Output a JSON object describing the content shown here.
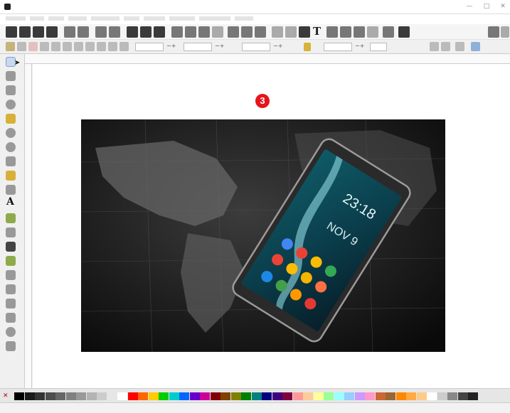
{
  "window": {
    "title": "",
    "minimize_label": "—",
    "maximize_label": "□",
    "close_label": "✕"
  },
  "menu": [],
  "toolbar_text_tool": "T",
  "canvas": {
    "step_marker": "3"
  },
  "tools": [
    {
      "name": "selector-tool",
      "icon": "arrow-icon"
    },
    {
      "name": "node-tool",
      "icon": "node-icon"
    },
    {
      "name": "rectangle-tool",
      "icon": "rectangle-icon"
    },
    {
      "name": "circle-tool",
      "icon": "circle-icon"
    },
    {
      "name": "star-tool",
      "icon": "star-icon"
    },
    {
      "name": "spiral-tool",
      "icon": "spiral-icon"
    },
    {
      "name": "pencil-tool",
      "icon": "pencil-icon"
    },
    {
      "name": "pen-tool",
      "icon": "pen-icon"
    },
    {
      "name": "calligraphy-tool",
      "icon": "calligraphy-icon"
    },
    {
      "name": "text-tool",
      "icon": "text-icon",
      "glyph": "A"
    },
    {
      "name": "spray-tool",
      "icon": "spray-icon"
    },
    {
      "name": "eraser-tool",
      "icon": "eraser-icon"
    },
    {
      "name": "dropper-tool",
      "icon": "dropper-icon"
    },
    {
      "name": "gradient-tool",
      "icon": "gradient-icon"
    },
    {
      "name": "mesh-tool",
      "icon": "mesh-icon"
    },
    {
      "name": "bucket-tool",
      "icon": "bucket-icon"
    },
    {
      "name": "tweak-tool",
      "icon": "tweak-icon"
    },
    {
      "name": "connector-tool",
      "icon": "connector-icon"
    },
    {
      "name": "measure-tool",
      "icon": "measure-icon"
    },
    {
      "name": "zoom-tool",
      "icon": "zoom-icon"
    },
    {
      "name": "3d-box-tool",
      "icon": "3d-box-icon"
    }
  ],
  "photo": {
    "phone_time": "23:18",
    "phone_date": "NOV 9"
  },
  "colors": {
    "marker": "#e8141a",
    "palette": [
      "#000000",
      "#1a1a1a",
      "#333333",
      "#4d4d4d",
      "#666666",
      "#808080",
      "#999999",
      "#b3b3b3",
      "#cccccc",
      "#e6e6e6",
      "#ffffff",
      "#ff0000",
      "#ff6600",
      "#ffcc00",
      "#00cc00",
      "#00cccc",
      "#0066ff",
      "#6600cc",
      "#cc0099",
      "#800000",
      "#804000",
      "#808000",
      "#008000",
      "#008080",
      "#000080",
      "#400080",
      "#800040",
      "#ff9999",
      "#ffcc99",
      "#ffff99",
      "#99ff99",
      "#99ffff",
      "#99ccff",
      "#cc99ff",
      "#ff99cc",
      "#cc6633",
      "#996633",
      "#ff8800",
      "#ffaa44",
      "#ffcc88",
      "#ffffff",
      "#cccccc",
      "#888888",
      "#444444",
      "#222222"
    ]
  },
  "status": {
    "fill_label": "",
    "stroke_label": "",
    "layer_label": "",
    "message": "",
    "coords": "",
    "zoom": ""
  }
}
